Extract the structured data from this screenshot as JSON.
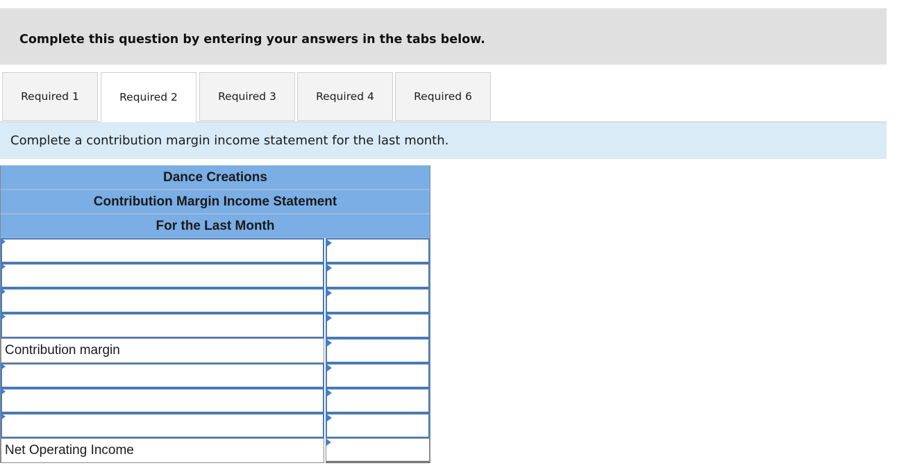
{
  "instructions": {
    "text": "Complete this question by entering your answers in the tabs below."
  },
  "tabs": [
    {
      "label": "Required 1",
      "active": false
    },
    {
      "label": "Required 2",
      "active": true
    },
    {
      "label": "Required 3",
      "active": false
    },
    {
      "label": "Required 4",
      "active": false
    },
    {
      "label": "Required 6",
      "active": false
    }
  ],
  "prompt": {
    "text": "Complete a contribution margin income statement for the last month."
  },
  "statement": {
    "company": "Dance Creations",
    "title": "Contribution Margin Income Statement",
    "period": "For the Last Month",
    "rows": [
      {
        "label": "",
        "amount": ""
      },
      {
        "label": "",
        "amount": ""
      },
      {
        "label": "",
        "amount": ""
      },
      {
        "label": "",
        "amount": ""
      },
      {
        "label": "Contribution margin",
        "amount": ""
      },
      {
        "label": "",
        "amount": ""
      },
      {
        "label": "",
        "amount": ""
      },
      {
        "label": "",
        "amount": ""
      },
      {
        "label": "Net Operating Income",
        "amount": ""
      }
    ]
  },
  "colors": {
    "header_blue": "#7aaee5",
    "prompt_bg": "#d9ebf7",
    "banner_bg": "#e0e0e0",
    "input_border": "#4a7ab5",
    "marker": "#3f7fcf"
  }
}
